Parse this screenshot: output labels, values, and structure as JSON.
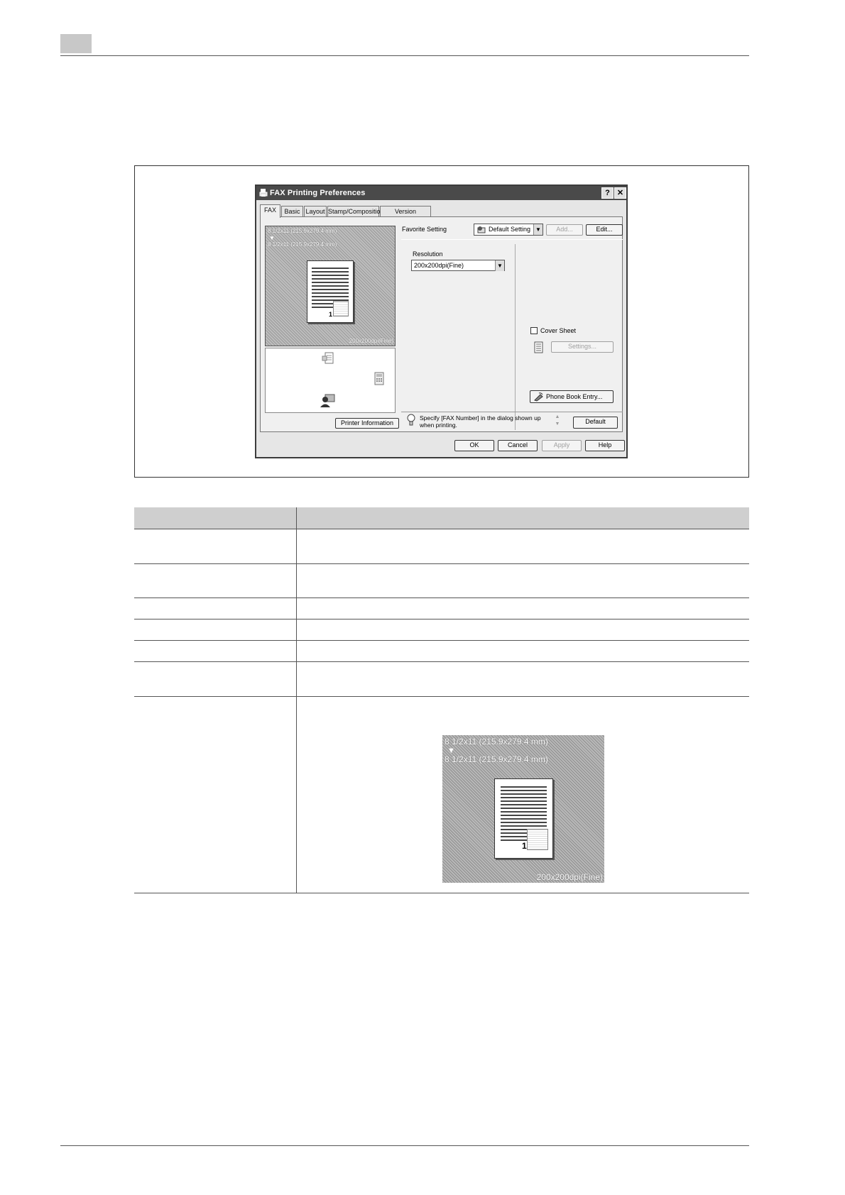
{
  "dialog": {
    "title": "FAX Printing Preferences",
    "help_glyph": "?",
    "close_glyph": "✕",
    "tabs": [
      {
        "label": "FAX"
      },
      {
        "label": "Basic"
      },
      {
        "label": "Layout"
      },
      {
        "label": "Stamp/Composition"
      },
      {
        "label": "Version Information"
      }
    ],
    "preview": {
      "paper_size_from": "8 1/2x11 (215.9x279.4 mm)",
      "arrow": "▼",
      "paper_size_to": "8 1/2x11 (215.9x279.4 mm)",
      "resolution": "200x200dpi(Fine)",
      "page_number": "1"
    },
    "printer_information_button": "Printer Information",
    "favorite_setting": {
      "label": "Favorite Setting",
      "value": "Default Setting",
      "add_button": "Add...",
      "edit_button": "Edit..."
    },
    "resolution": {
      "label": "Resolution",
      "value": "200x200dpi(Fine)"
    },
    "cover_sheet": {
      "label": "Cover Sheet",
      "checked": false,
      "settings_button": "Settings..."
    },
    "phone_book_button": "Phone Book Entry...",
    "hint_text": "Specify [FAX Number] in the dialog shown up when printing.",
    "default_button": "Default",
    "footer": {
      "ok": "OK",
      "cancel": "Cancel",
      "apply": "Apply",
      "help": "Help"
    }
  },
  "figure2": {
    "paper_size_from": "8 1/2x11 (215.9x279.4 mm)",
    "arrow": "▼",
    "paper_size_to": "8 1/2x11 (215.9x279.4 mm)",
    "resolution": "200x200dpi(Fine)",
    "page_number": "1"
  },
  "colors": {
    "titlebar": "#4a4a4a",
    "table_header": "#cfcfcf",
    "dialog_face": "#e6e6e6"
  }
}
